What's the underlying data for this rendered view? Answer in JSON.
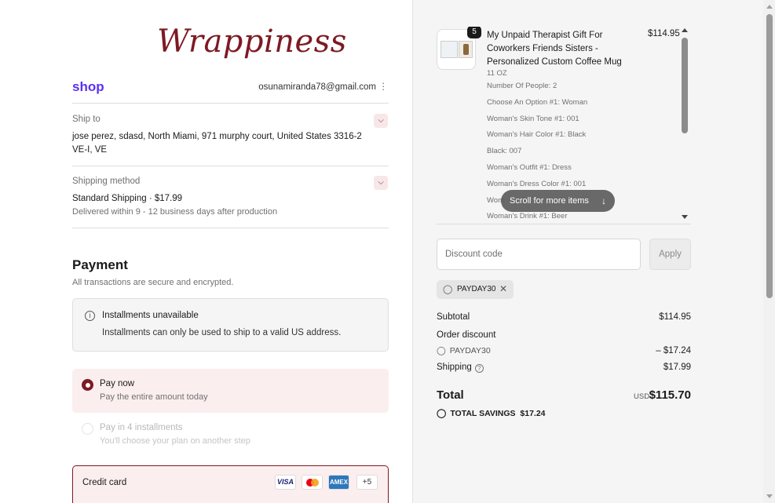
{
  "brand": {
    "logo_text": "Wrappiness",
    "accent": "#7c1a22",
    "shop_color": "#5a31f4"
  },
  "header": {
    "shop_label": "shop",
    "email": "osunamiranda78@gmail.com"
  },
  "ship_to": {
    "label": "Ship to",
    "address": "jose perez, sdasd, North Miami, 971 murphy court, United States 3316-2 VE-I, VE"
  },
  "shipping_method": {
    "label": "Shipping method",
    "name": "Standard Shipping · $17.99",
    "note": "Delivered within 9 - 12 business days after production"
  },
  "payment": {
    "title": "Payment",
    "subtitle": "All transactions are secure and encrypted.",
    "installments_title": "Installments unavailable",
    "installments_text": "Installments can only be used to ship to a valid US address.",
    "pay_now_label": "Pay now",
    "pay_now_sub": "Pay the entire amount today",
    "pay4_label": "Pay in 4 installments",
    "pay4_sub": "You'll choose your plan on another step",
    "credit_card_label": "Credit card",
    "card_brands": [
      "VISA",
      "Mastercard",
      "AMEX"
    ],
    "more_cards": "+5"
  },
  "order": {
    "item": {
      "quantity": "5",
      "title": "My Unpaid Therapist Gift For Coworkers Friends Sisters - Personalized Custom Coffee Mug",
      "price": "$114.95",
      "options": [
        "11 OZ",
        "Number Of People: 2",
        "Choose An Option #1: Woman",
        "Woman's Skin Tone #1: 001",
        "Woman's Hair Color #1: Black",
        "Black: 007",
        "Woman's Outfit #1: Dress",
        "Woman's Dress Color #1: 001",
        "Wom",
        "Woman's Drink #1: Beer"
      ]
    },
    "scroll_hint": "Scroll for more items",
    "discount_placeholder": "Discount code",
    "apply_label": "Apply",
    "applied_code": "PAYDAY30",
    "subtotal_label": "Subtotal",
    "subtotal_value": "$114.95",
    "order_discount_label": "Order discount",
    "discount_code": "PAYDAY30",
    "discount_value": "– $17.24",
    "shipping_label": "Shipping",
    "shipping_value": "$17.99",
    "total_label": "Total",
    "currency": "USD",
    "total_value": "$115.70",
    "savings_label": "TOTAL SAVINGS",
    "savings_value": "$17.24"
  }
}
